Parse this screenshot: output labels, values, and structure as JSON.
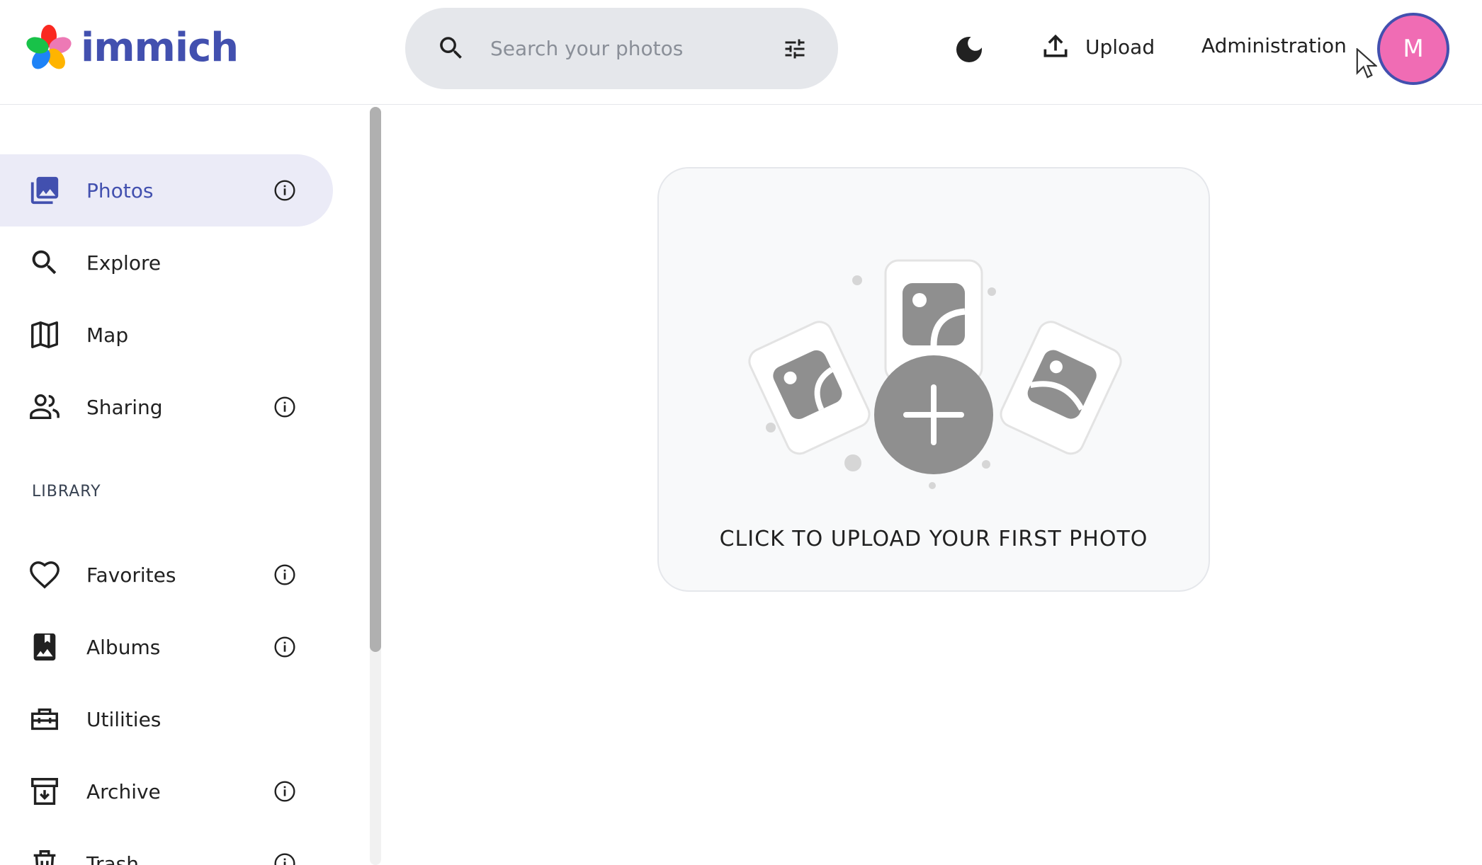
{
  "header": {
    "logo_text": "immich",
    "search": {
      "placeholder": "Search your photos",
      "value": ""
    },
    "upload_label": "Upload",
    "administration_label": "Administration",
    "avatar_initial": "M"
  },
  "sidebar": {
    "items": [
      {
        "label": "Photos",
        "icon": "photos-icon",
        "active": true,
        "has_info": true
      },
      {
        "label": "Explore",
        "icon": "search-icon",
        "active": false,
        "has_info": false
      },
      {
        "label": "Map",
        "icon": "map-icon",
        "active": false,
        "has_info": false
      },
      {
        "label": "Sharing",
        "icon": "people-icon",
        "active": false,
        "has_info": true
      }
    ],
    "library_title": "LIBRARY",
    "library_items": [
      {
        "label": "Favorites",
        "icon": "heart-icon",
        "has_info": true
      },
      {
        "label": "Albums",
        "icon": "album-icon",
        "has_info": true
      },
      {
        "label": "Utilities",
        "icon": "toolbox-icon",
        "has_info": false
      },
      {
        "label": "Archive",
        "icon": "archive-icon",
        "has_info": true
      },
      {
        "label": "Trash",
        "icon": "trash-icon",
        "has_info": true
      }
    ]
  },
  "main": {
    "empty_cta": "CLICK TO UPLOAD YOUR FIRST PHOTO"
  },
  "colors": {
    "brand": "#4250af",
    "avatar_bg": "#f06cb4",
    "active_bg": "#ebebf7",
    "illustration_gray": "#8f8f8f"
  }
}
